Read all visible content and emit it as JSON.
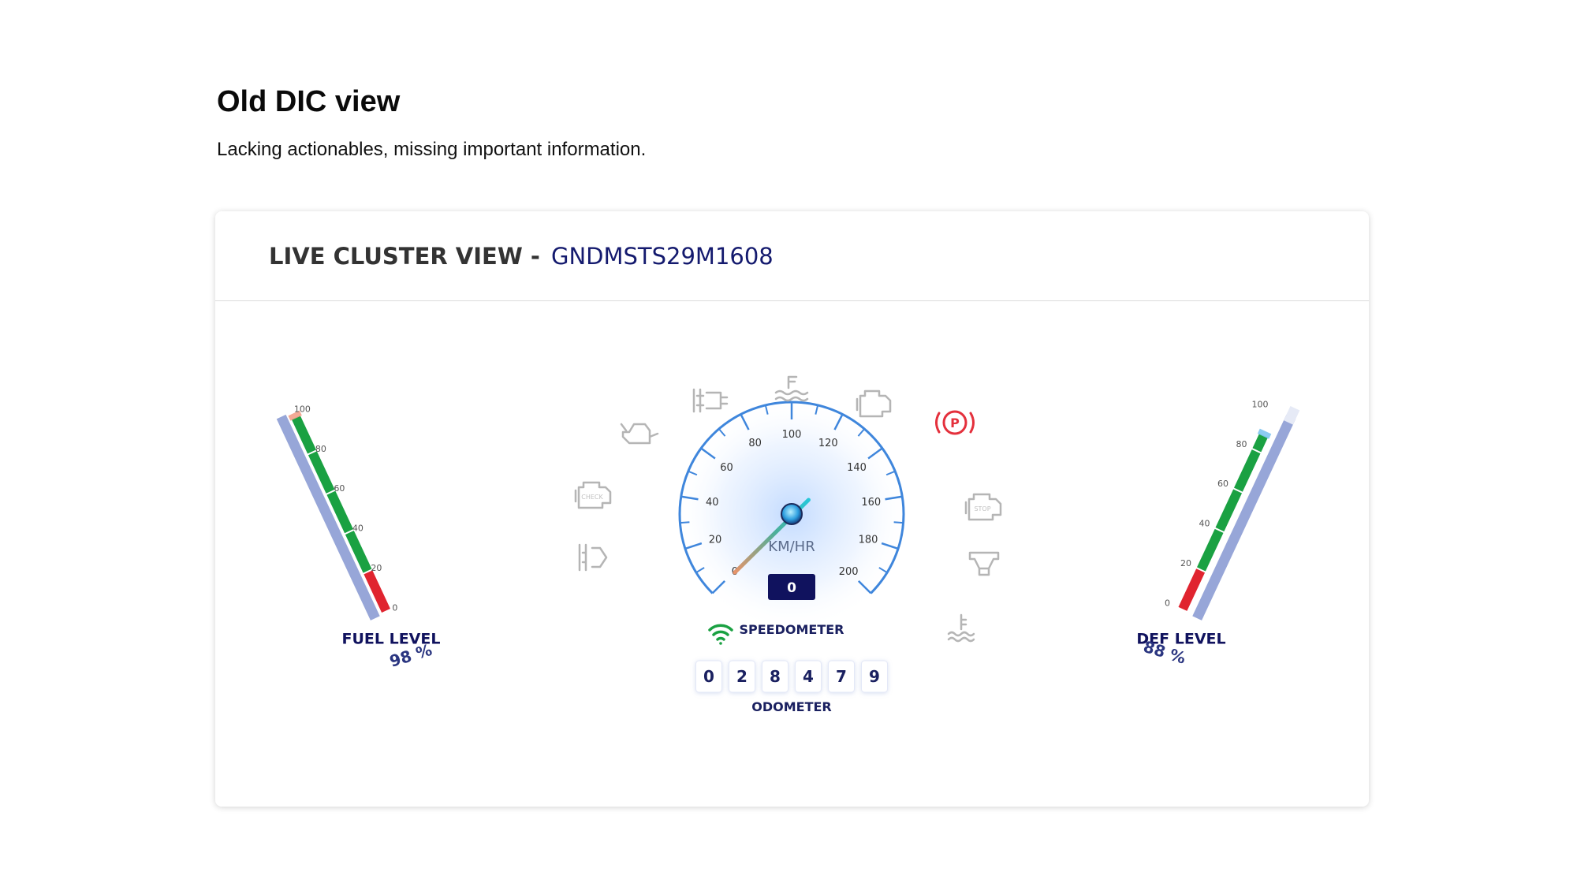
{
  "page": {
    "title": "Old DIC view",
    "subtitle": "Lacking actionables, missing important information."
  },
  "cluster": {
    "header_label": "LIVE CLUSTER VIEW -",
    "vehicle_id": "GNDMSTS29M1608"
  },
  "fuel_gauge": {
    "label": "FUEL LEVEL",
    "value_text": "98 %",
    "value_percent": 98,
    "ticks": [
      "0",
      "20",
      "40",
      "60",
      "80",
      "100"
    ]
  },
  "def_gauge": {
    "label": "DEF LEVEL",
    "value_text": "88 %",
    "value_percent": 88,
    "ticks": [
      "0",
      "20",
      "40",
      "60",
      "80",
      "100"
    ]
  },
  "speedometer": {
    "label": "SPEEDOMETER",
    "unit": "KM/HR",
    "speed_value": "0",
    "ticks": [
      "0",
      "20",
      "40",
      "60",
      "80",
      "100",
      "120",
      "140",
      "160",
      "180",
      "200"
    ]
  },
  "odometer": {
    "label": "ODOMETER",
    "digits": [
      "0",
      "2",
      "8",
      "4",
      "7",
      "9"
    ]
  },
  "warning_icons": [
    "engine-check-icon",
    "glow-plug-icon",
    "oil-can-icon",
    "exhaust-filter-icon",
    "coolant-level-icon",
    "engine-icon",
    "parking-brake-icon",
    "stop-engine-icon",
    "transmission-icon",
    "coolant-temperature-icon",
    "network-signal-icon"
  ],
  "colors": {
    "accent_blue": "#3f86dc",
    "navy": "#10125e",
    "green": "#1aa142",
    "red": "#e0242f",
    "parking_red": "#e4303c",
    "icon_gray": "#b3b3b3"
  }
}
